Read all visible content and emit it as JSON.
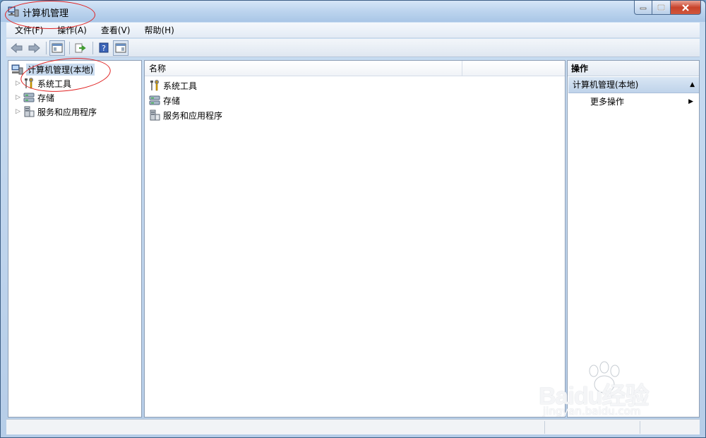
{
  "window": {
    "title": "计算机管理"
  },
  "menubar": {
    "items": [
      "文件(F)",
      "操作(A)",
      "查看(V)",
      "帮助(H)"
    ]
  },
  "tree": {
    "root": "计算机管理(本地)",
    "children": [
      "系统工具",
      "存储",
      "服务和应用程序"
    ]
  },
  "list": {
    "column_name": "名称",
    "rows": [
      "系统工具",
      "存储",
      "服务和应用程序"
    ]
  },
  "actions": {
    "header": "操作",
    "section": "计算机管理(本地)",
    "more": "更多操作"
  },
  "watermark": {
    "brand": "Baidu经验",
    "url": "jingyan.baidu.com"
  },
  "colors": {
    "annotation": "#e02020",
    "selected_section": "#c9dbef"
  }
}
